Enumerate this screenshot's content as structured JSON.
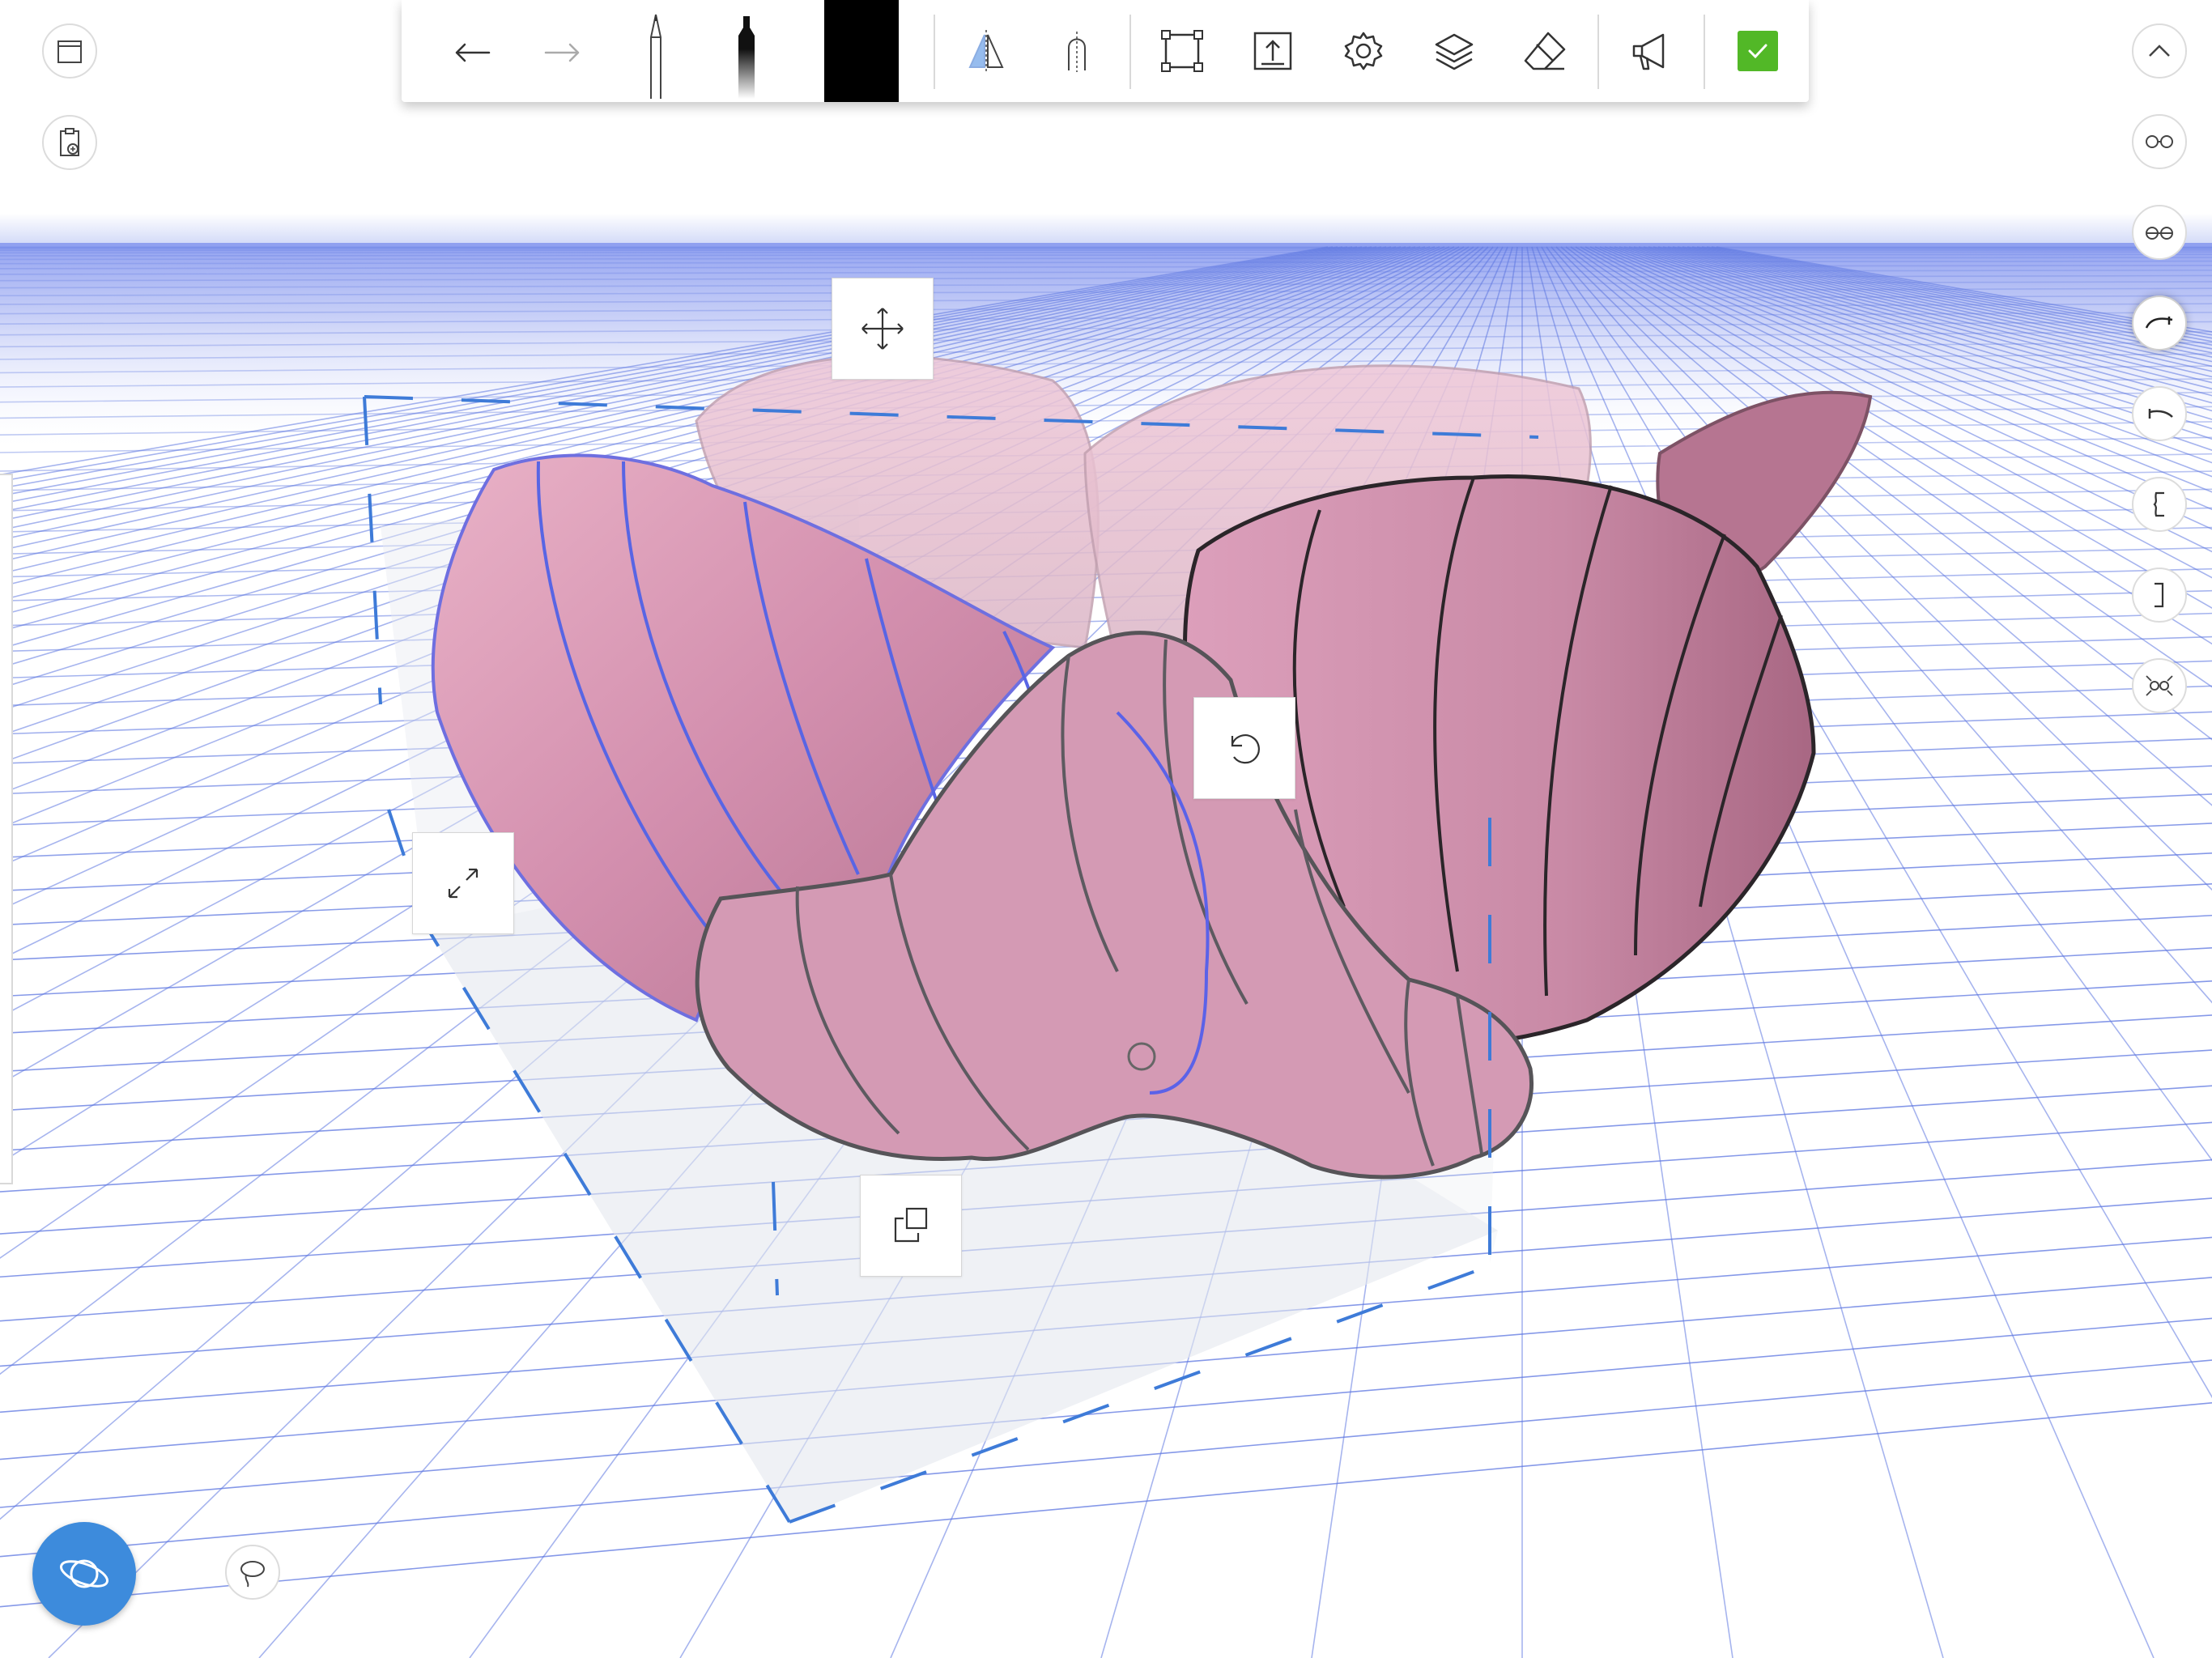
{
  "toolbar": {
    "undo_icon": "undo-arrow-icon",
    "redo_icon": "redo-arrow-icon",
    "pencil_icon": "pencil-tool-icon",
    "marker_icon": "marker-tool-icon",
    "active_color": "#000000",
    "symmetry_icon": "symmetry-mirror-icon",
    "curve_guide_icon": "curve-guide-icon",
    "transform_icon": "transform-box-icon",
    "export_icon": "export-upload-icon",
    "settings_icon": "gear-icon",
    "layers_icon": "layers-icon",
    "eraser_icon": "eraser-icon",
    "feedback_icon": "megaphone-icon",
    "confirm_icon": "checkmark-icon",
    "confirm_color": "#52b827"
  },
  "left_controls": {
    "window_icon": "window-frame-icon",
    "paste_icon": "clipboard-paste-icon"
  },
  "right_rail": {
    "items": [
      {
        "icon": "collapse-chevron-up-icon"
      },
      {
        "icon": "glasses-view-icon"
      },
      {
        "icon": "glasses-alt-view-icon"
      },
      {
        "icon": "stroke-end-cap-icon"
      },
      {
        "icon": "stroke-start-cap-icon"
      },
      {
        "icon": "bracket-left-icon"
      },
      {
        "icon": "bracket-right-icon"
      },
      {
        "icon": "fit-view-glasses-icon"
      }
    ],
    "active_index": 3
  },
  "manipulators": {
    "move_icon": "move-arrows-icon",
    "rotate_icon": "rotate-icon",
    "scale_icon": "scale-arrows-icon",
    "duplicate_icon": "duplicate-icon"
  },
  "bottom": {
    "orbit_button_icon": "orbit-planet-icon",
    "orbit_button_color": "#3d8bdc",
    "lasso_icon": "lasso-icon"
  },
  "scene": {
    "grid_color": "#5c76e0",
    "petal_color": "#d896b2",
    "selection_color": "#3e7bd8"
  }
}
